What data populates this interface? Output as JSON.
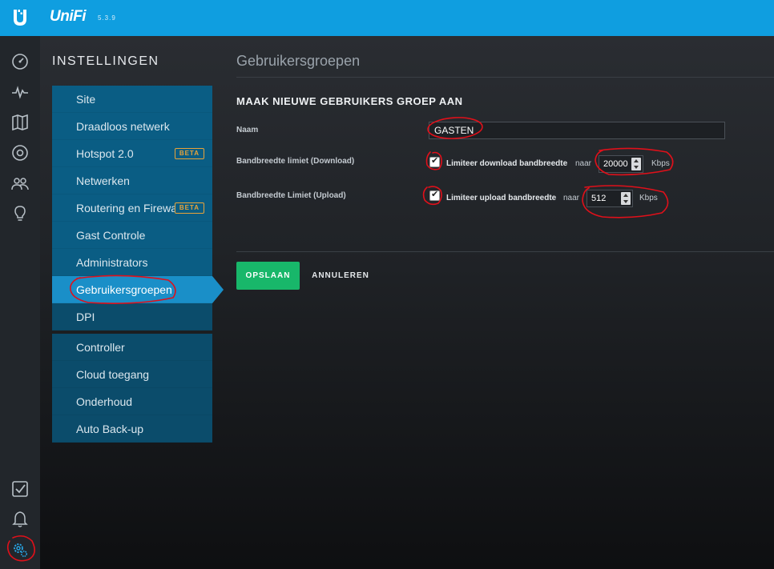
{
  "header": {
    "brand": "UniFi",
    "version": "5.3.9"
  },
  "leftnav": {
    "icons": [
      "dashboard-icon",
      "statistics-icon",
      "map-icon",
      "devices-icon",
      "clients-icon",
      "insights-icon",
      "tasks-icon",
      "alerts-icon",
      "settings-icon"
    ]
  },
  "settings": {
    "title": "INSTELLINGEN",
    "items": [
      {
        "label": "Site"
      },
      {
        "label": "Draadloos netwerk"
      },
      {
        "label": "Hotspot 2.0",
        "badge": "BETA"
      },
      {
        "label": "Netwerken"
      },
      {
        "label": "Routering en Firewall",
        "badge": "BETA"
      },
      {
        "label": "Gast Controle"
      },
      {
        "label": "Administrators"
      },
      {
        "label": "Gebruikersgroepen"
      },
      {
        "label": "DPI"
      }
    ],
    "items2": [
      {
        "label": "Controller"
      },
      {
        "label": "Cloud toegang"
      },
      {
        "label": "Onderhoud"
      },
      {
        "label": "Auto Back-up"
      }
    ],
    "active": "Gebruikersgroepen"
  },
  "page": {
    "title": "Gebruikersgroepen",
    "section_title": "MAAK NIEUWE GEBRUIKERS GROEP AAN",
    "name_label": "Naam",
    "name_value": "GASTEN",
    "download": {
      "label": "Bandbreedte limiet (Download)",
      "checkbox_label": "Limiteer download bandbreedte",
      "checked": true,
      "to": "naar",
      "value": "20000",
      "unit": "Kbps"
    },
    "upload": {
      "label": "Bandbreedte Limiet (Upload)",
      "checkbox_label": "Limiteer upload bandbreedte",
      "checked": true,
      "to": "naar",
      "value": "512",
      "unit": "Kbps"
    },
    "save_label": "OPSLAAN",
    "cancel_label": "ANNULEREN"
  },
  "colors": {
    "header": "#0f9ee0",
    "active": "#1a8fc8",
    "save": "#18b76a",
    "annotation": "#e0101a",
    "beta": "#e8a33a"
  }
}
